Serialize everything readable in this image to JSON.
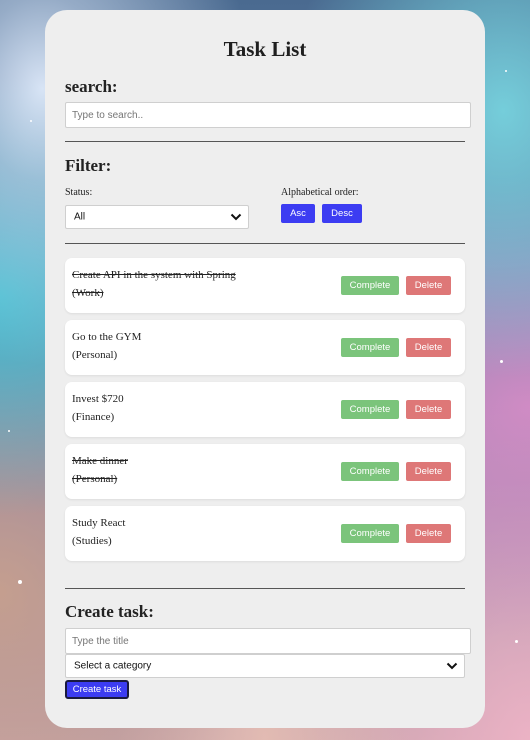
{
  "page": {
    "title": "Task List"
  },
  "search": {
    "heading": "search:",
    "placeholder": "Type to search.."
  },
  "filter": {
    "heading": "Filter:",
    "status_label": "Status:",
    "status_value": "All",
    "order_label": "Alphabetical order:",
    "asc_label": "Asc",
    "desc_label": "Desc"
  },
  "tasks": [
    {
      "title": "Create API in the system with Spring",
      "category": "(Work)",
      "completed": true,
      "complete_label": "Complete",
      "delete_label": "Delete"
    },
    {
      "title": "Go to the GYM",
      "category": "(Personal)",
      "completed": false,
      "complete_label": "Complete",
      "delete_label": "Delete"
    },
    {
      "title": "Invest $720",
      "category": "(Finance)",
      "completed": false,
      "complete_label": "Complete",
      "delete_label": "Delete"
    },
    {
      "title": "Make dinner",
      "category": "(Personal)",
      "completed": true,
      "complete_label": "Complete",
      "delete_label": "Delete"
    },
    {
      "title": "Study React",
      "category": "(Studies)",
      "completed": false,
      "complete_label": "Complete",
      "delete_label": "Delete"
    }
  ],
  "create": {
    "heading": "Create task:",
    "title_placeholder": "Type the title",
    "category_placeholder": "Select a category",
    "button_label": "Create task"
  },
  "colors": {
    "primary_button": "#3c3cf2",
    "complete_button": "#7bc47b",
    "delete_button": "#de7777",
    "card_background": "#eeeeee"
  },
  "icons": {
    "status_dropdown": "chevron-down-icon",
    "category_dropdown": "chevron-down-icon"
  }
}
